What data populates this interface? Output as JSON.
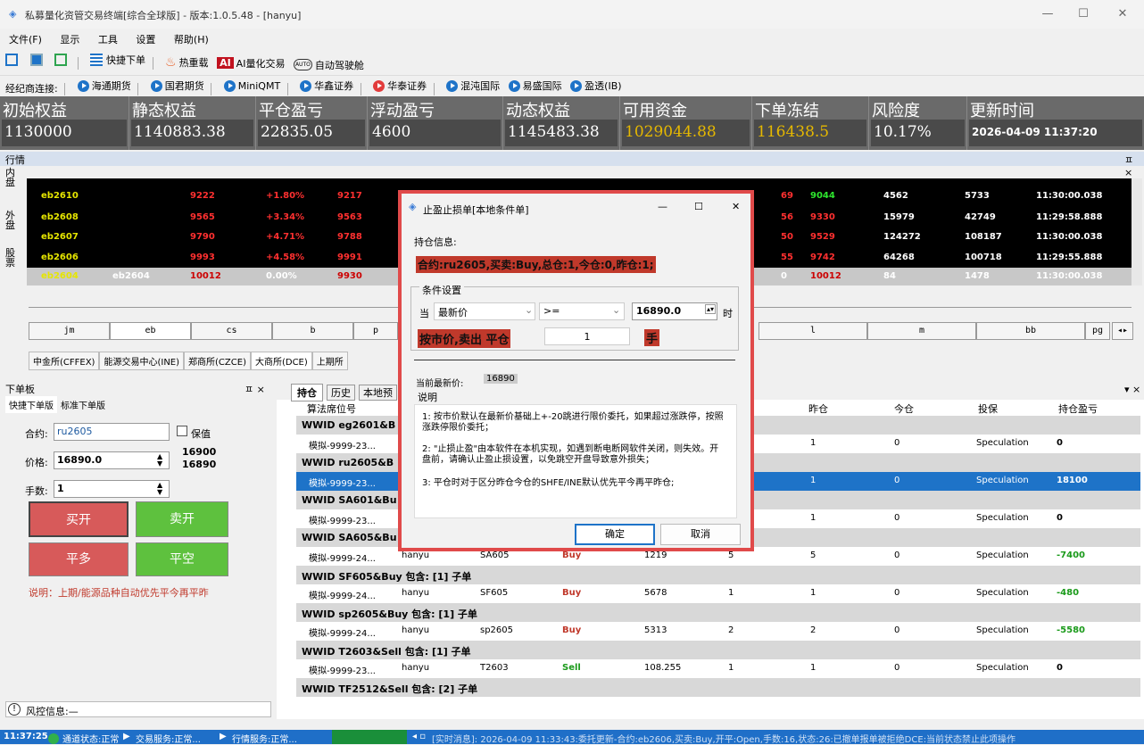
{
  "window": {
    "title": "私募量化资管交易终端[综合全球版] - 版本:1.0.5.48 - [hanyu]",
    "minimize": "—",
    "maximize": "☐",
    "close": "✕"
  },
  "menu": [
    "文件(F)",
    "显示",
    "工具",
    "设置",
    "帮助(H)"
  ],
  "toolbar1": {
    "quick_order": "快捷下单",
    "hot_reload": "热重载",
    "ai_label": "AI",
    "ai_trade": "AI量化交易",
    "auto_label": "AUTO",
    "auto_trade": "自动驾驶舱"
  },
  "toolbar2": {
    "broker_label": "经纪商连接:",
    "brokers": [
      "海通期货",
      "国君期货",
      "MiniQMT",
      "华鑫证券",
      "华泰证券",
      "混沌国际",
      "易盛国际",
      "盈透(IB)"
    ]
  },
  "account": [
    {
      "label": "初始权益",
      "value": "1130000"
    },
    {
      "label": "静态权益",
      "value": "1140883.38"
    },
    {
      "label": "平仓盈亏",
      "value": "22835.05"
    },
    {
      "label": "浮动盈亏",
      "value": "4600"
    },
    {
      "label": "动态权益",
      "value": "1145483.38"
    },
    {
      "label": "可用资金",
      "value": "1029044.88"
    },
    {
      "label": "下单冻结",
      "value": "116438.5"
    },
    {
      "label": "风险度",
      "value": "10.17%"
    },
    {
      "label": "更新时间",
      "value": "2026-04-09 11:37:20"
    }
  ],
  "quote_panel": {
    "title": "行情",
    "side_tabs": [
      "内盘",
      "外盘",
      "股票"
    ],
    "pin": "ㅍ ×"
  },
  "quotes": [
    {
      "code": "eb2610",
      "name": "",
      "last": "9222",
      "chg": "+1.80%",
      "bid": "9217",
      "c5": "69",
      "c6": "9044",
      "vol": "4562",
      "oi": "5733",
      "time": "11:30:00.038"
    },
    {
      "code": "eb2608",
      "name": "",
      "last": "9565",
      "chg": "+3.34%",
      "bid": "9563",
      "c5": "56",
      "c6": "9330",
      "vol": "15979",
      "oi": "42749",
      "time": "11:29:58.888"
    },
    {
      "code": "eb2607",
      "name": "",
      "last": "9790",
      "chg": "+4.71%",
      "bid": "9788",
      "c5": "50",
      "c6": "9529",
      "vol": "124272",
      "oi": "108187",
      "time": "11:30:00.038"
    },
    {
      "code": "eb2606",
      "name": "",
      "last": "9993",
      "chg": "+4.58%",
      "bid": "9991",
      "c5": "55",
      "c6": "9742",
      "vol": "64268",
      "oi": "100718",
      "time": "11:29:55.888"
    },
    {
      "code": "eb2604",
      "name": "eb2604",
      "last": "10012",
      "chg": "0.00%",
      "bid": "9930",
      "c5": "0",
      "c6": "10012",
      "vol": "84",
      "oi": "1478",
      "time": "11:30:00.038"
    }
  ],
  "symbols": [
    "jm",
    "eb",
    "cs",
    "b",
    "p",
    "",
    "",
    "",
    "",
    "",
    "l",
    "m",
    "bb",
    "pg"
  ],
  "exchanges": [
    "中金所(CFFEX)",
    "能源交易中心(INE)",
    "郑商所(CZCE)",
    "大商所(DCE)",
    "上期所"
  ],
  "order_panel": {
    "title": "下单板",
    "pin": "ㅍ ×",
    "tabs": [
      "快捷下单版",
      "标准下单版"
    ],
    "contract_label": "合约:",
    "contract": "ru2605",
    "hedge_label": "保值",
    "price_label": "价格:",
    "price": "16890.0",
    "up": "16900",
    "down": "16890",
    "qty_label": "手数:",
    "qty": "1",
    "buy_open": "买开",
    "sell_open": "卖开",
    "close_long": "平多",
    "close_short": "平空",
    "note": "说明：上期/能源品种自动优先平今再平昨",
    "risk": "风控信息:—"
  },
  "grid": {
    "tabs": [
      "持仓",
      "历史",
      "本地预"
    ],
    "columns": [
      "算法席位号",
      "",
      "",
      "",
      "",
      "",
      "昨仓",
      "今仓",
      "投保",
      "持仓盈亏"
    ],
    "rows": [
      {
        "type": "group",
        "text": "WWID  eg2601&B"
      },
      {
        "type": "row",
        "seat": "模拟-9999-23...",
        "user": "",
        "code": "",
        "dir": "",
        "price": "",
        "total": "",
        "yd": "1",
        "td": "0",
        "hedge": "Speculation",
        "pnl": "0"
      },
      {
        "type": "group",
        "text": "WWID  ru2605&B"
      },
      {
        "type": "row",
        "sel": true,
        "seat": "模拟-9999-23...",
        "user": "",
        "code": "",
        "dir": "",
        "price": "",
        "total": "",
        "yd": "1",
        "td": "0",
        "hedge": "Speculation",
        "pnl": "18100"
      },
      {
        "type": "group",
        "text": "WWID  SA601&Bu"
      },
      {
        "type": "row",
        "seat": "模拟-9999-23...",
        "user": "",
        "code": "",
        "dir": "",
        "price": "",
        "total": "",
        "yd": "1",
        "td": "0",
        "hedge": "Speculation",
        "pnl": "0"
      },
      {
        "type": "group",
        "text": "WWID  SA605&Bu"
      },
      {
        "type": "row",
        "seat": "模拟-9999-24...",
        "user": "hanyu",
        "code": "SA605",
        "dir": "Buy",
        "price": "1219",
        "total": "5",
        "yd": "5",
        "td": "0",
        "hedge": "Speculation",
        "pnl": "-7400"
      },
      {
        "type": "group",
        "text": "WWID  SF605&Buy  包含: [1] 子单"
      },
      {
        "type": "row",
        "seat": "模拟-9999-24...",
        "user": "hanyu",
        "code": "SF605",
        "dir": "Buy",
        "price": "5678",
        "total": "1",
        "yd": "1",
        "td": "0",
        "hedge": "Speculation",
        "pnl": "-480"
      },
      {
        "type": "group",
        "text": "WWID  sp2605&Buy  包含: [1] 子单"
      },
      {
        "type": "row",
        "seat": "模拟-9999-24...",
        "user": "hanyu",
        "code": "sp2605",
        "dir": "Buy",
        "price": "5313",
        "total": "2",
        "yd": "2",
        "td": "0",
        "hedge": "Speculation",
        "pnl": "-5580"
      },
      {
        "type": "group",
        "text": "WWID  T2603&Sell  包含: [1] 子单"
      },
      {
        "type": "row",
        "seat": "模拟-9999-23...",
        "user": "hanyu",
        "code": "T2603",
        "dir": "Sell",
        "price": "108.255",
        "total": "1",
        "yd": "1",
        "td": "0",
        "hedge": "Speculation",
        "pnl": "0"
      },
      {
        "type": "group",
        "text": "WWID  TF2512&Sell  包含: [2] 子单"
      }
    ]
  },
  "dialog": {
    "title": "止盈止损单[本地条件单]",
    "hold_label": "持仓信息:",
    "hold_info": "合约:ru2605,买卖:Buy,总仓:1,今仓:0,昨仓:1;",
    "cond_label": "条件设置",
    "when": "当",
    "field": "最新价",
    "op": ">=",
    "trigger": "16890.0",
    "time_suffix": "时",
    "action": "按市价,卖出 平仓",
    "qty": "1",
    "unit": "手",
    "last_label": "当前最新价:",
    "last": "16890",
    "desc_label": "说明",
    "desc1": "1: 按市价默认在最新价基础上+-20跳进行限价委托，如果超过涨跌停，按照涨跌停限价委托；",
    "desc2": "2: \"止损止盈\"由本软件在本机实现，如遇到断电断网软件关闭，则失效。开盘前，请确认止盈止损设置，以免跳空开盘导致意外损失；",
    "desc3": "3: 平仓时对于区分昨仓今仓的SHFE/INE默认优先平今再平昨仓;",
    "ok": "确定",
    "cancel": "取消"
  },
  "status": {
    "time": "11:37:25",
    "channel": "通道状态:正常",
    "trade": "交易服务:正常...",
    "market": "行情服务:正常...",
    "msg": "[实时消息]: 2026-04-09 11:33:43:委托更新-合约:eb2606,买卖:Buy,开平:Open,手数:16,状态:26:已撤单报单被拒绝DCE:当前状态禁止此项操作"
  }
}
